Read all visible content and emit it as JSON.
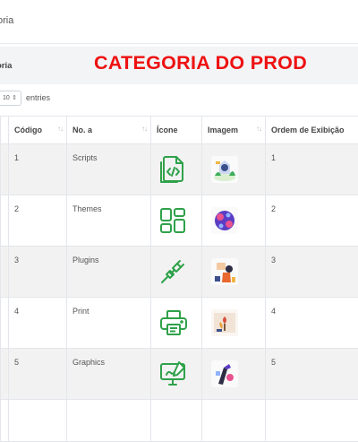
{
  "header": {
    "title": "oria"
  },
  "section": {
    "label": "oria"
  },
  "banner": {
    "text": "CATEGORIA DO PROD"
  },
  "length": {
    "value": "10",
    "suffix": "entries"
  },
  "table": {
    "columns": [
      "Código",
      "No. a",
      "Ícone",
      "Imagem",
      "Ordem de Exibição"
    ],
    "rows": [
      {
        "code": "1",
        "name": "Scripts",
        "icon": "code-file-icon",
        "image": "scripts-illustration",
        "order": "1"
      },
      {
        "code": "2",
        "name": "Themes",
        "icon": "themes-grid-icon",
        "image": "themes-illustration",
        "order": "2"
      },
      {
        "code": "3",
        "name": "Plugins",
        "icon": "plug-icon",
        "image": "plugins-illustration",
        "order": "3"
      },
      {
        "code": "4",
        "name": "Print",
        "icon": "printer-icon",
        "image": "print-illustration",
        "order": "4"
      },
      {
        "code": "5",
        "name": "Graphics",
        "icon": "graphics-monitor-icon",
        "image": "graphics-illustration",
        "order": "5"
      }
    ]
  },
  "colors": {
    "icon_green": "#2fa14a",
    "banner_red": "#ee1111",
    "stripe": "#f2f2f2"
  }
}
